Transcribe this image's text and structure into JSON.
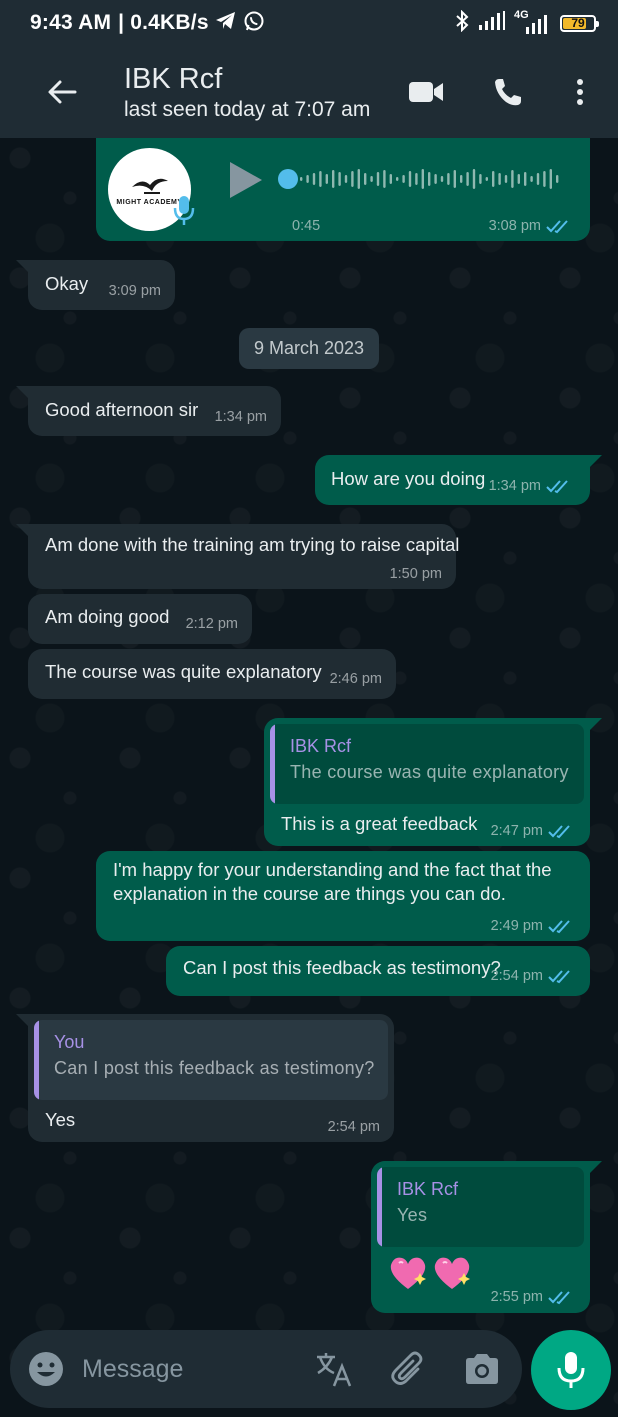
{
  "status_bar": {
    "time": "9:43 AM",
    "network_speed": "| 0.4KB/s",
    "network_type": "4G",
    "battery_level": "79",
    "battery_fraction": 0.79,
    "icons": [
      "telegram-icon",
      "whatsapp-icon",
      "bluetooth-icon",
      "signal-icon",
      "battery-icon"
    ]
  },
  "header": {
    "contact_name": "IBK Rcf",
    "last_seen": "last seen today at 7:07 am",
    "icons": [
      "back-arrow-icon",
      "video-call-icon",
      "voice-call-icon",
      "more-options-icon"
    ]
  },
  "messages": {
    "voice_note": {
      "logo_text": "MIGHT ACADEMY",
      "duration": "0:45",
      "time": "3:08 pm",
      "played_fraction": 0.0
    },
    "okay": {
      "text": "Okay",
      "time": "3:09 pm"
    },
    "date_separator": "9 March 2023",
    "good_afternoon": {
      "text": "Good afternoon sir",
      "time": "1:34 pm"
    },
    "how_are_you": {
      "text": "How are you doing",
      "time": "1:34 pm"
    },
    "am_done": {
      "text": "Am done with the training am trying to raise capital",
      "time": "1:50 pm"
    },
    "am_doing_good": {
      "text": "Am doing good",
      "time": "2:12 pm"
    },
    "course_explanatory": {
      "text": "The course was quite explanatory",
      "time": "2:46 pm"
    },
    "great_feedback": {
      "quote_author": "IBK Rcf",
      "quote_text": "The course was quite explanatory",
      "text": "This is a great feedback",
      "time": "2:47 pm"
    },
    "happy_understanding": {
      "text": "I'm happy for your understanding and the fact that the explanation in the course are things you can do.",
      "time": "2:49 pm"
    },
    "post_testimony": {
      "text": "Can I post this feedback as testimony?",
      "time": "2:54 pm"
    },
    "yes_reply": {
      "quote_author": "You",
      "quote_text": "Can I post this feedback as testimony?",
      "text": "Yes",
      "time": "2:54 pm"
    },
    "hearts_reply": {
      "quote_author": "IBK Rcf",
      "quote_text": "Yes",
      "emoji": "sparkling-heart-icon x2",
      "time": "2:55 pm"
    }
  },
  "input_bar": {
    "placeholder": "Message",
    "icons": [
      "emoji-icon",
      "translate-icon",
      "attach-icon",
      "camera-icon",
      "mic-icon"
    ]
  },
  "colors": {
    "background": "#0b141a",
    "header": "#1f2c34",
    "incoming_bubble": "#202c33",
    "outgoing_bubble": "#005c4b",
    "accent": "#00a884",
    "read_ticks": "#53bdeb",
    "quote_author": "#a791e6",
    "battery": "#f2b92b"
  }
}
